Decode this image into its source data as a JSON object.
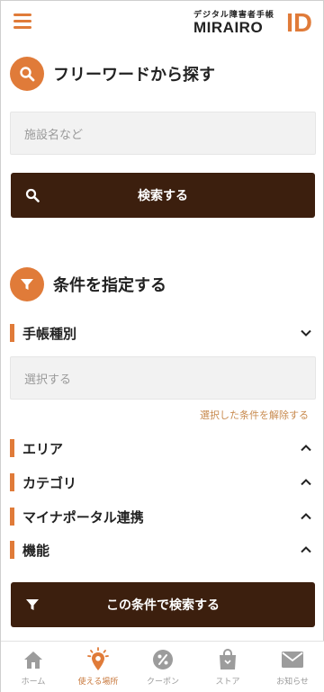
{
  "header": {
    "logo_sub": "デジタル障害者手帳",
    "logo_main": "MIRAIRO",
    "logo_id": "ID"
  },
  "freeword": {
    "title": "フリーワードから探す",
    "placeholder": "施設名など",
    "search_button": "検索する"
  },
  "conditions": {
    "title": "条件を指定する",
    "techou": {
      "label": "手帳種別",
      "select_placeholder": "選択する",
      "clear_link": "選択した条件を解除する"
    },
    "filters": [
      {
        "label": "エリア"
      },
      {
        "label": "カテゴリ"
      },
      {
        "label": "マイナポータル連携"
      },
      {
        "label": "機能"
      }
    ],
    "search_button": "この条件で検索する"
  },
  "bottom_nav": {
    "items": [
      {
        "label": "ホーム",
        "icon": "home-icon",
        "active": false
      },
      {
        "label": "使える場所",
        "icon": "map-pin-icon",
        "active": true
      },
      {
        "label": "クーポン",
        "icon": "coupon-icon",
        "active": false
      },
      {
        "label": "ストア",
        "icon": "shopping-bag-icon",
        "active": false
      },
      {
        "label": "お知らせ",
        "icon": "mail-icon",
        "active": false
      }
    ]
  },
  "colors": {
    "accent": "#e07b39",
    "button_dark": "#3c1f0e",
    "link": "#c88a4e"
  }
}
